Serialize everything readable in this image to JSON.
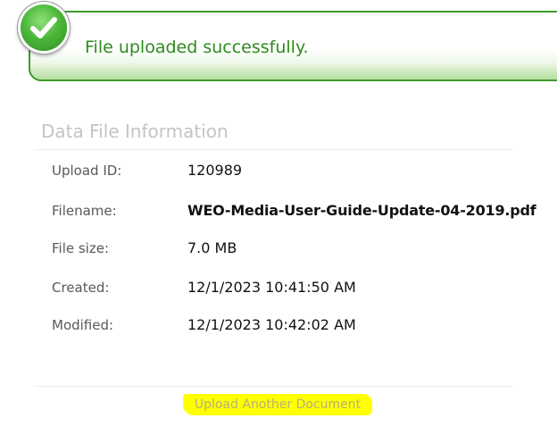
{
  "banner": {
    "message": "File uploaded successfully.",
    "icon": "checkmark-icon",
    "color": "#2e8a1c"
  },
  "info": {
    "title": "Data File Information",
    "rows": [
      {
        "label": "Upload ID:",
        "value": "120989"
      },
      {
        "label": "Filename:",
        "value": "WEO-Media-User-Guide-Update-04-2019.pdf"
      },
      {
        "label": "File size:",
        "value": "7.0 MB"
      },
      {
        "label": "Created:",
        "value": "12/1/2023 10:41:50 AM"
      },
      {
        "label": "Modified:",
        "value": "12/1/2023 10:42:02 AM"
      }
    ]
  },
  "footer": {
    "upload_another_label": "Upload Another Document",
    "highlight_color": "#ffff00"
  }
}
